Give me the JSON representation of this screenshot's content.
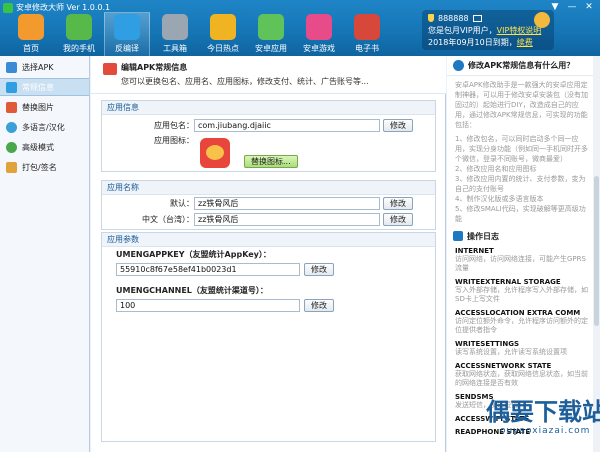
{
  "window": {
    "title": "安卓修改大师 Ver 1.0.0.1",
    "controls": [
      "▼",
      "—",
      "✕"
    ]
  },
  "toolbar": [
    {
      "label": "首页",
      "color": "#f29a2e"
    },
    {
      "label": "我的手机",
      "color": "#57b94a"
    },
    {
      "label": "反编译",
      "color": "#2f9ee3"
    },
    {
      "label": "工具箱",
      "color": "#9aa6b2"
    },
    {
      "label": "今日热点",
      "color": "#f0b423"
    },
    {
      "label": "安卓应用",
      "color": "#5fc35a"
    },
    {
      "label": "安卓游戏",
      "color": "#e84b8a"
    },
    {
      "label": "电子书",
      "color": "#d7473a"
    }
  ],
  "user": {
    "id": "888888",
    "line2_prefix": "您是包月VIP用户，",
    "vip_link": "VIP特权说明",
    "line3_prefix": "2018年09月10日到期，",
    "renew_link": "续费"
  },
  "sidebar": [
    {
      "label": "选择APK",
      "color": "#3a8ad6"
    },
    {
      "label": "常规信息",
      "color": "#2f9ee3"
    },
    {
      "label": "替换图片",
      "color": "#e05a3a"
    },
    {
      "label": "多语言/汉化",
      "color": "#3aa0d6"
    },
    {
      "label": "高级模式",
      "color": "#4aa84a"
    },
    {
      "label": "打包/签名",
      "color": "#e0a23a"
    }
  ],
  "main": {
    "title": "编辑APK常规信息",
    "desc": "您可以更换包名、应用名、应用图标，修改支付、统计、广告账号等...",
    "app_info": {
      "title": "应用信息",
      "package_label": "应用包名：",
      "package_value": "com.jiubang.djaiic",
      "package_btn": "修改",
      "icon_label": "应用图标：",
      "replace_icon_btn": "替换图标..."
    },
    "app_name": {
      "title": "应用名称",
      "default_label": "默认：",
      "default_value": "zz铁骨风后",
      "default_btn": "修改",
      "tw_label": "中文（台湾）：",
      "tw_value": "zz铁骨风后",
      "tw_btn": "修改"
    },
    "params": {
      "title": "应用参数",
      "key1": "UMENGAPPKEY（友盟统计AppKey）：",
      "value1": "55910c8f67e58ef41b0023d1",
      "btn1": "修改",
      "key2": "UMENGCHANNEL（友盟统计渠道号）：",
      "value2": "100",
      "btn2": "修改"
    }
  },
  "right": {
    "help_title": "修改APK常规信息有什么用？",
    "help_lines": [
      "安卓APK修改助手是一款强大的安卓应用定制神器，可以用于修改安卓安装包（没有加固过的）起始进行DIY，改造成自己的应用，通过修改APK常规信息，可实现的功能包括：",
      "",
      "1、修改包名，可以同时启动多个同一应用，实现分身功能（例如同一手机同时开多个微信，登录不同账号，微商最爱）",
      "2、修改应用名和应用图标",
      "3、修改应用内置的统计、支付参数，变为自己的支付账号",
      "4、制作汉化版或多语言版本",
      "5、修改SMALI代码，实现破解等更高级功能"
    ],
    "log_title": "操作日志",
    "perms": [
      {
        "name": "INTERNET",
        "desc": "访问网络，访问网络连接，可能产生GPRS流量"
      },
      {
        "name": "WRITEEXTERNAL STORAGE",
        "desc": "写入外部存储，允许程序写入外部存储，如SD卡上写文件"
      },
      {
        "name": "ACCESSLOCATION EXTRA COMM",
        "desc": "访问定位额外命令，允许程序访问额外的定位提供者指令"
      },
      {
        "name": "WRITESETTINGS",
        "desc": "读写系统设置，允许读写系统设置项"
      },
      {
        "name": "ACCESSNETWORK STATE",
        "desc": "获取网络状态，获取网络信息状态，如当前的网络连接是否有效"
      },
      {
        "name": "SENDSMS",
        "desc": "发送短信，发送短信"
      },
      {
        "name": "ACCESSWIFI STATE",
        "desc": ""
      },
      {
        "name": "READPHONE STATE",
        "desc": ""
      }
    ]
  },
  "watermark": {
    "text": "偶要下载站",
    "url": "ouyaoxiazai.com"
  }
}
